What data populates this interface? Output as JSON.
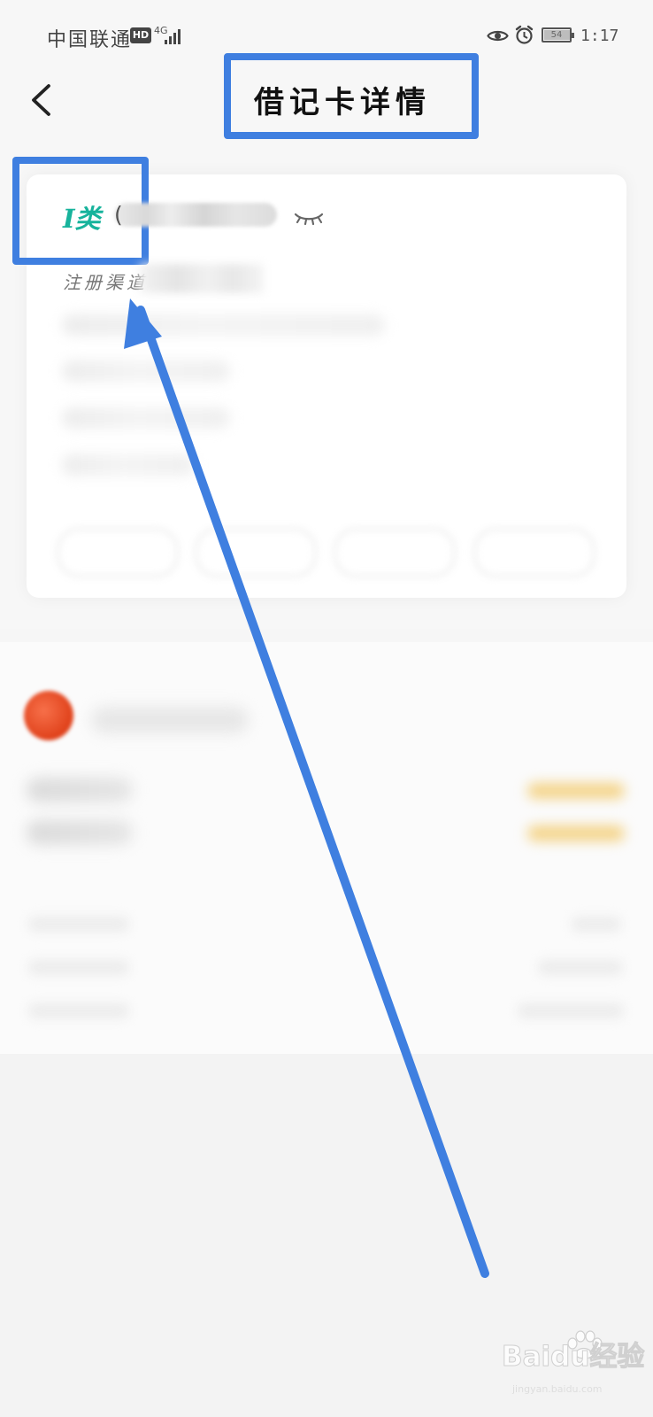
{
  "status_bar": {
    "carrier": "中国联通",
    "hd": "HD",
    "network": "4G",
    "battery": "54",
    "time": "1:17"
  },
  "header": {
    "title": "借记卡详情"
  },
  "card": {
    "class_label": "I类",
    "number_prefix": "(",
    "register_label": "注册渠道"
  },
  "watermark": {
    "brand": "Baidu经验",
    "site": "jingyan.baidu.com"
  },
  "colors": {
    "accent": "#3f7fe0",
    "class_text": "#17b39c",
    "background": "#f6f6f6"
  },
  "icons": {
    "back": "chevron-left-icon",
    "eye": "eye-icon",
    "alarm": "alarm-clock-icon",
    "hidden": "eye-closed-icon"
  }
}
